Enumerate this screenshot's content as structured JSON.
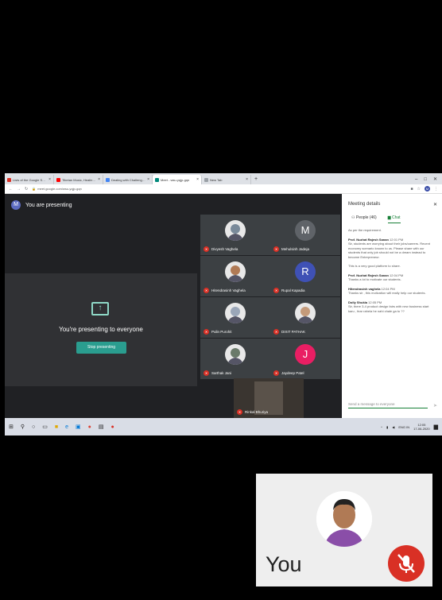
{
  "browser": {
    "tabs": [
      {
        "label": "Lists of the Google Sheet for T",
        "color": "#d93025"
      },
      {
        "label": "Tibetan Music, Healing Music",
        "color": "#ff0000"
      },
      {
        "label": "Dealing with Challenging Clas",
        "color": "#4285f4"
      },
      {
        "label": "Meet - wsu-yqjp-gqn",
        "color": "#00897b",
        "active": true
      },
      {
        "label": "New Tab",
        "color": "#9aa0a6"
      }
    ],
    "new_tab_symbol": "+",
    "window_controls": [
      "–",
      "□",
      "✕"
    ],
    "url": "meet.google.com/wsu-yqjp-gqn",
    "profile_initial": "M"
  },
  "meet": {
    "presenter_initial": "M",
    "presenting_status": "You are presenting",
    "present_message": "You're presenting to everyone",
    "stop_button": "Stop presenting"
  },
  "participants": [
    {
      "name": "Divyesh Vaghela",
      "type": "photo"
    },
    {
      "name": "Mehulsinh Jadeja",
      "type": "letter",
      "letter": "M",
      "color": "#5f6368"
    },
    {
      "name": "Hitendrasinh Vaghela",
      "type": "photo"
    },
    {
      "name": "Rupal Kapadia",
      "type": "letter",
      "letter": "R",
      "color": "#3f51b5"
    },
    {
      "name": "Pulin Purohit",
      "type": "photo"
    },
    {
      "name": "DIXIT PATHAK",
      "type": "photo"
    },
    {
      "name": "Sarthak Jani",
      "type": "photo"
    },
    {
      "name": "Jaydeep Patel",
      "type": "letter",
      "letter": "J",
      "color": "#e91e63"
    },
    {
      "name": "Rinkal Bhuriya",
      "type": "video"
    }
  ],
  "sidebar": {
    "title": "Meeting details",
    "people_tab": "People (46)",
    "chat_tab": "Chat",
    "messages": [
      {
        "who": "",
        "time": "",
        "text": "As per the requirement."
      },
      {
        "who": "Prof. Nuzhat Rajesh Sanan",
        "time": "12:01 PM",
        "text": "Sir, students are worrying about their jobs/careers. Recent economy scenario known to us. Please share with our students that only job should not be a dream instead to become Entrepreneur."
      },
      {
        "who": "",
        "time": "",
        "text": "This is a very good platform to share."
      },
      {
        "who": "Prof. Nuzhat Rajesh Sanan",
        "time": "12:04 PM",
        "text": "Thanks a lot to motivate our students."
      },
      {
        "who": "Hitendrasinh vaghela",
        "time": "12:04 PM",
        "text": "Thanks sir , this motivation will really help our students."
      },
      {
        "who": "Dolly Shukla",
        "time": "12:05 PM",
        "text": "Sir, there 3-4 product design fairs with new business start karu , fear rahela he nahi chale ga to ??"
      }
    ],
    "input_placeholder": "Send a message to everyone",
    "send_icon": "send-icon"
  },
  "taskbar": {
    "apps": [
      "windows-icon",
      "search-icon",
      "cortana-icon",
      "task-view-icon",
      "file-explorer-icon",
      "edge-icon",
      "store-icon",
      "chrome-icon",
      "photos-icon",
      "app-icon"
    ],
    "tray_lang": "ENG",
    "tray_region": "IN",
    "time": "12:05",
    "date": "17-06-2020"
  },
  "selfview": {
    "label": "You"
  }
}
